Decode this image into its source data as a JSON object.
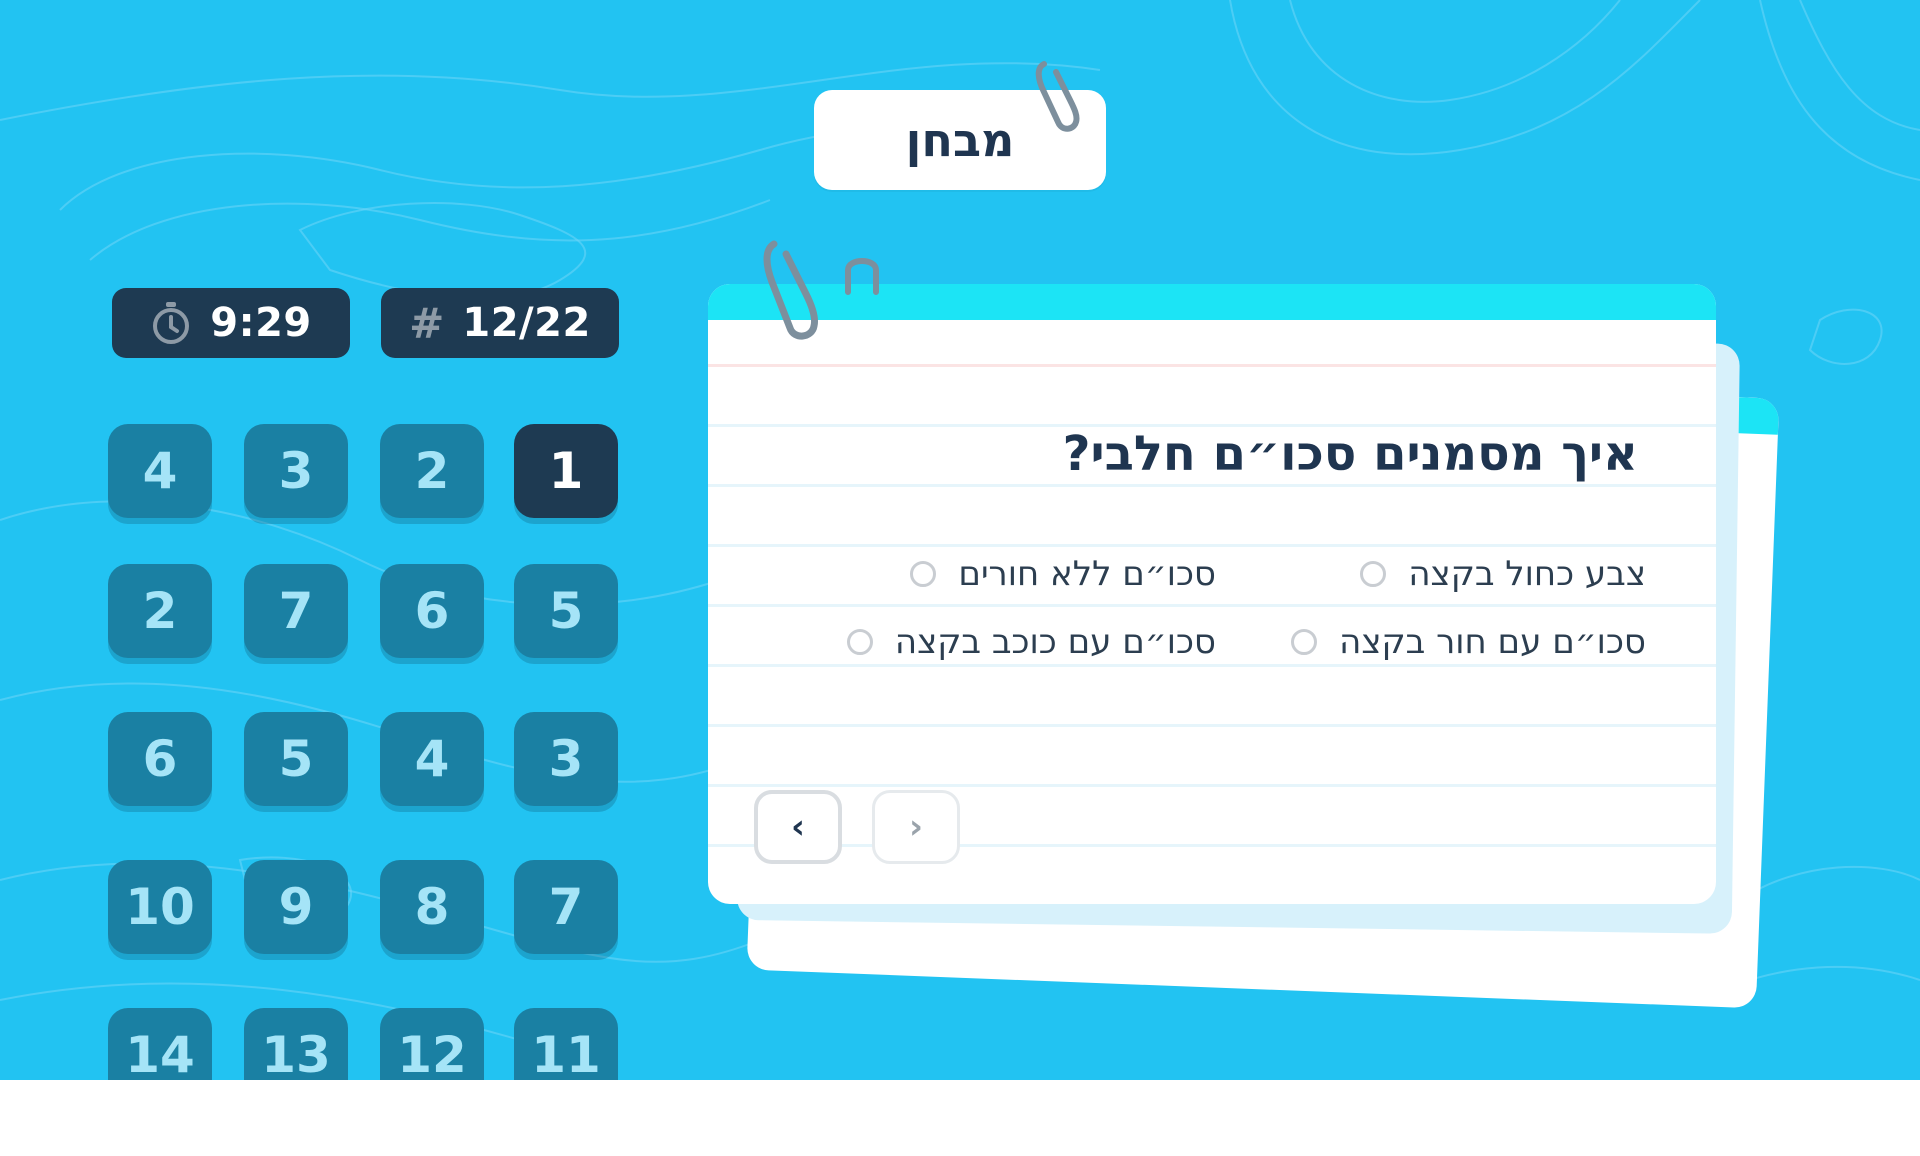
{
  "header": {
    "title": "מבחן"
  },
  "status": {
    "timer": "9:29",
    "timer_icon": "stopwatch-icon",
    "counter": "12/22",
    "counter_icon": "#"
  },
  "questions_grid": [
    {
      "label": "1",
      "active": true
    },
    {
      "label": "2"
    },
    {
      "label": "3"
    },
    {
      "label": "4"
    },
    {
      "label": "5"
    },
    {
      "label": "6"
    },
    {
      "label": "7"
    },
    {
      "label": "2"
    },
    {
      "label": "3"
    },
    {
      "label": "4"
    },
    {
      "label": "5"
    },
    {
      "label": "6"
    },
    {
      "label": "7"
    },
    {
      "label": "8"
    },
    {
      "label": "9"
    },
    {
      "label": "10"
    },
    {
      "label": "11"
    },
    {
      "label": "12"
    },
    {
      "label": "13"
    },
    {
      "label": "14"
    }
  ],
  "card": {
    "question": "איך מסמנים סכו״ם חלבי?",
    "options": [
      "צבע כחול בקצה",
      "סכו״ם ללא חורים",
      "סכו״ם עם חור בקצה",
      "סכו״ם עם כוכב בקצה"
    ],
    "nav": {
      "prev": "‹",
      "next": "›"
    }
  },
  "colors": {
    "background": "#22c3f2",
    "dark": "#1e3a52",
    "tile": "#1a80a3",
    "accent_bar": "#1ce4f5"
  }
}
